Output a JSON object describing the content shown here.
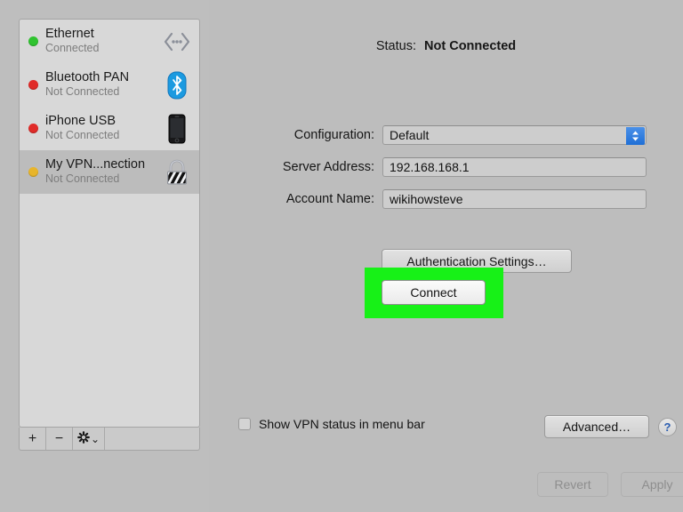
{
  "window": {
    "pane": "network-preferences"
  },
  "sidebar": {
    "services": [
      {
        "name": "Ethernet",
        "state": "Connected",
        "dot_color": "#2fc32f",
        "icon": "ethernet-icon",
        "selected": false
      },
      {
        "name": "Bluetooth PAN",
        "state": "Not Connected",
        "dot_color": "#e02b28",
        "icon": "bluetooth-icon",
        "selected": false
      },
      {
        "name": "iPhone USB",
        "state": "Not Connected",
        "dot_color": "#e02b28",
        "icon": "iphone-icon",
        "selected": false
      },
      {
        "name": "My VPN...nection",
        "state": "Not Connected",
        "dot_color": "#e8b52b",
        "icon": "vpn-lock-icon",
        "selected": true
      }
    ],
    "toolbar": {
      "add_label": "+",
      "remove_label": "−",
      "action_label": "⚙",
      "action_chevron": "⌄"
    }
  },
  "main": {
    "status": {
      "label": "Status:",
      "value": "Not Connected"
    },
    "fields": {
      "configuration": {
        "label": "Configuration:",
        "value": "Default",
        "options": [
          "Default"
        ]
      },
      "server_address": {
        "label": "Server Address:",
        "value": "192.168.168.1",
        "placeholder": ""
      },
      "account_name": {
        "label": "Account Name:",
        "value": "wikihowsteve",
        "placeholder": ""
      }
    },
    "auth_settings_label": "Authentication Settings…",
    "connect_label": "Connect",
    "show_status_checkbox": {
      "label": "Show VPN status in menu bar",
      "checked": false
    },
    "advanced_label": "Advanced…",
    "help_label": "?"
  },
  "footer": {
    "revert_label": "Revert",
    "apply_label": "Apply"
  },
  "highlight": {
    "color": "#17f117",
    "target": "connect-button"
  }
}
